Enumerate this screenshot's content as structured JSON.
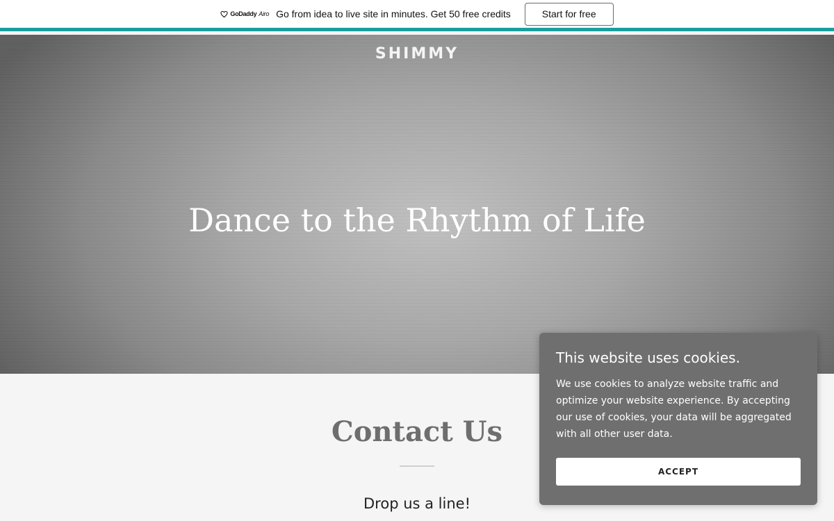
{
  "promo": {
    "logo_brand": "GoDaddy",
    "logo_product": "Airo",
    "text": "Go from idea to live site in minutes. Get 50 free credits",
    "button_label": "Start for free"
  },
  "colors": {
    "promo_accent": "#1a9e9e",
    "cookie_bg": "#6f6f6f"
  },
  "hero": {
    "brand": "SHIMMY",
    "title": "Dance to the Rhythm of Life"
  },
  "contact": {
    "title": "Contact Us",
    "subtitle": "Drop us a line!"
  },
  "cookie": {
    "title": "This website uses cookies.",
    "body": "We use cookies to analyze website traffic and optimize your website experience. By accepting our use of cookies, your data will be aggregated with all other user data.",
    "accept_label": "ACCEPT"
  }
}
